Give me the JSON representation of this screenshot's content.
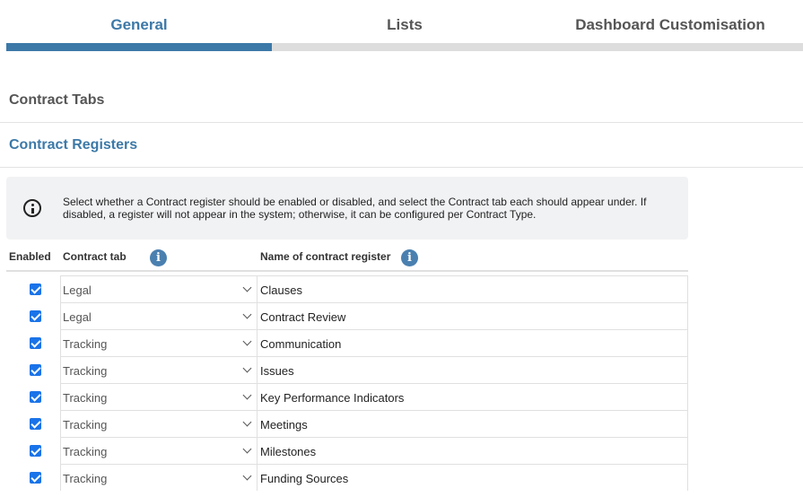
{
  "tabs": [
    {
      "label": "General",
      "active": true
    },
    {
      "label": "Lists",
      "active": false
    },
    {
      "label": "Dashboard Customisation",
      "active": false
    }
  ],
  "sections": {
    "contract_tabs": "Contract Tabs",
    "contract_registers": "Contract Registers"
  },
  "info_text": "Select whether a Contract register should be enabled or disabled, and select the Contract tab each should appear under. If disabled, a register will not appear in the system; otherwise, it can be configured per Contract Type.",
  "table": {
    "headers": {
      "enabled": "Enabled",
      "contract_tab": "Contract tab",
      "name": "Name of contract register",
      "info_glyph": "i"
    },
    "rows": [
      {
        "enabled": true,
        "tab": "Legal",
        "name": "Clauses"
      },
      {
        "enabled": true,
        "tab": "Legal",
        "name": "Contract Review"
      },
      {
        "enabled": true,
        "tab": "Tracking",
        "name": "Communication"
      },
      {
        "enabled": true,
        "tab": "Tracking",
        "name": "Issues"
      },
      {
        "enabled": true,
        "tab": "Tracking",
        "name": "Key Performance Indicators"
      },
      {
        "enabled": true,
        "tab": "Tracking",
        "name": "Meetings"
      },
      {
        "enabled": true,
        "tab": "Tracking",
        "name": "Milestones"
      },
      {
        "enabled": true,
        "tab": "Tracking",
        "name": "Funding Sources"
      }
    ]
  },
  "colors": {
    "accent": "#3c79a8",
    "checkbox": "#1a73e8",
    "info_bg": "#f1f2f4"
  },
  "icons": {
    "info_box": "info-circle-icon",
    "header_help": "info-filled-icon",
    "select": "chevron-down-icon",
    "checkbox": "checkmark-icon"
  }
}
